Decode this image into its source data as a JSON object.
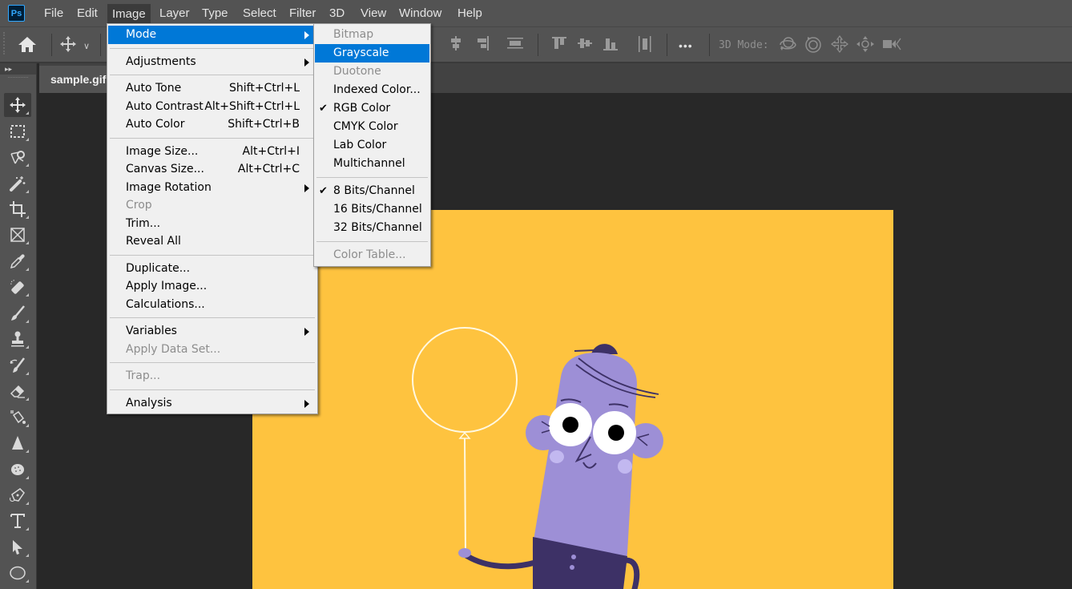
{
  "app": {
    "logo_text": "Ps",
    "menubar": [
      "File",
      "Edit",
      "Image",
      "Layer",
      "Type",
      "Select",
      "Filter",
      "3D",
      "View",
      "Window",
      "Help"
    ],
    "active_menu": "Image"
  },
  "options_bar": {
    "home_icon": "home-icon",
    "move_tool_icon": "move-icon",
    "align_icons": [
      "align-vertical-center-icon",
      "align-right-icon",
      "distribute-vertical-icon",
      "align-top-icon",
      "align-middle-icon",
      "align-bottom-icon",
      "distribute-horizontal-icon"
    ],
    "more_label": "•••",
    "mode_label": "3D Mode:",
    "mode_icons": [
      "orbit-3d-icon",
      "roll-3d-icon",
      "pan-3d-icon",
      "slide-3d-icon",
      "scale-3d-icon"
    ]
  },
  "document": {
    "tab_label": "sample.gif"
  },
  "tools": [
    "move",
    "rectangular-marquee",
    "lasso",
    "magic-wand",
    "crop",
    "frame",
    "eyedropper",
    "healing-brush",
    "brush",
    "clone-stamp",
    "history-brush",
    "eraser",
    "paint-bucket",
    "sharpen",
    "sponge",
    "pen",
    "type",
    "path-selection",
    "ellipse"
  ],
  "image_menu": [
    {
      "label": "Mode",
      "submenu": true,
      "highlight": true
    },
    {
      "sep": true
    },
    {
      "label": "Adjustments",
      "submenu": true
    },
    {
      "sep": true
    },
    {
      "label": "Auto Tone",
      "shortcut": "Shift+Ctrl+L"
    },
    {
      "label": "Auto Contrast",
      "shortcut": "Alt+Shift+Ctrl+L"
    },
    {
      "label": "Auto Color",
      "shortcut": "Shift+Ctrl+B"
    },
    {
      "sep": true
    },
    {
      "label": "Image Size...",
      "shortcut": "Alt+Ctrl+I"
    },
    {
      "label": "Canvas Size...",
      "shortcut": "Alt+Ctrl+C"
    },
    {
      "label": "Image Rotation",
      "submenu": true
    },
    {
      "label": "Crop",
      "disabled": true
    },
    {
      "label": "Trim..."
    },
    {
      "label": "Reveal All"
    },
    {
      "sep": true
    },
    {
      "label": "Duplicate..."
    },
    {
      "label": "Apply Image..."
    },
    {
      "label": "Calculations..."
    },
    {
      "sep": true
    },
    {
      "label": "Variables",
      "submenu": true
    },
    {
      "label": "Apply Data Set...",
      "disabled": true
    },
    {
      "sep": true
    },
    {
      "label": "Trap...",
      "disabled": true
    },
    {
      "sep": true
    },
    {
      "label": "Analysis",
      "submenu": true
    }
  ],
  "mode_menu": [
    {
      "label": "Bitmap",
      "disabled": true
    },
    {
      "label": "Grayscale",
      "highlight": true
    },
    {
      "label": "Duotone",
      "disabled": true
    },
    {
      "label": "Indexed Color..."
    },
    {
      "label": "RGB Color",
      "checked": true
    },
    {
      "label": "CMYK Color"
    },
    {
      "label": "Lab Color"
    },
    {
      "label": "Multichannel"
    },
    {
      "sep": true
    },
    {
      "label": "8 Bits/Channel",
      "checked": true
    },
    {
      "label": "16 Bits/Channel"
    },
    {
      "label": "32 Bits/Channel"
    },
    {
      "sep": true
    },
    {
      "label": "Color Table...",
      "disabled": true
    }
  ],
  "colors": {
    "accent": "#0078d7",
    "artboard": "#fec33f",
    "character_body": "#9d8fd6",
    "character_dark": "#3d3166"
  }
}
